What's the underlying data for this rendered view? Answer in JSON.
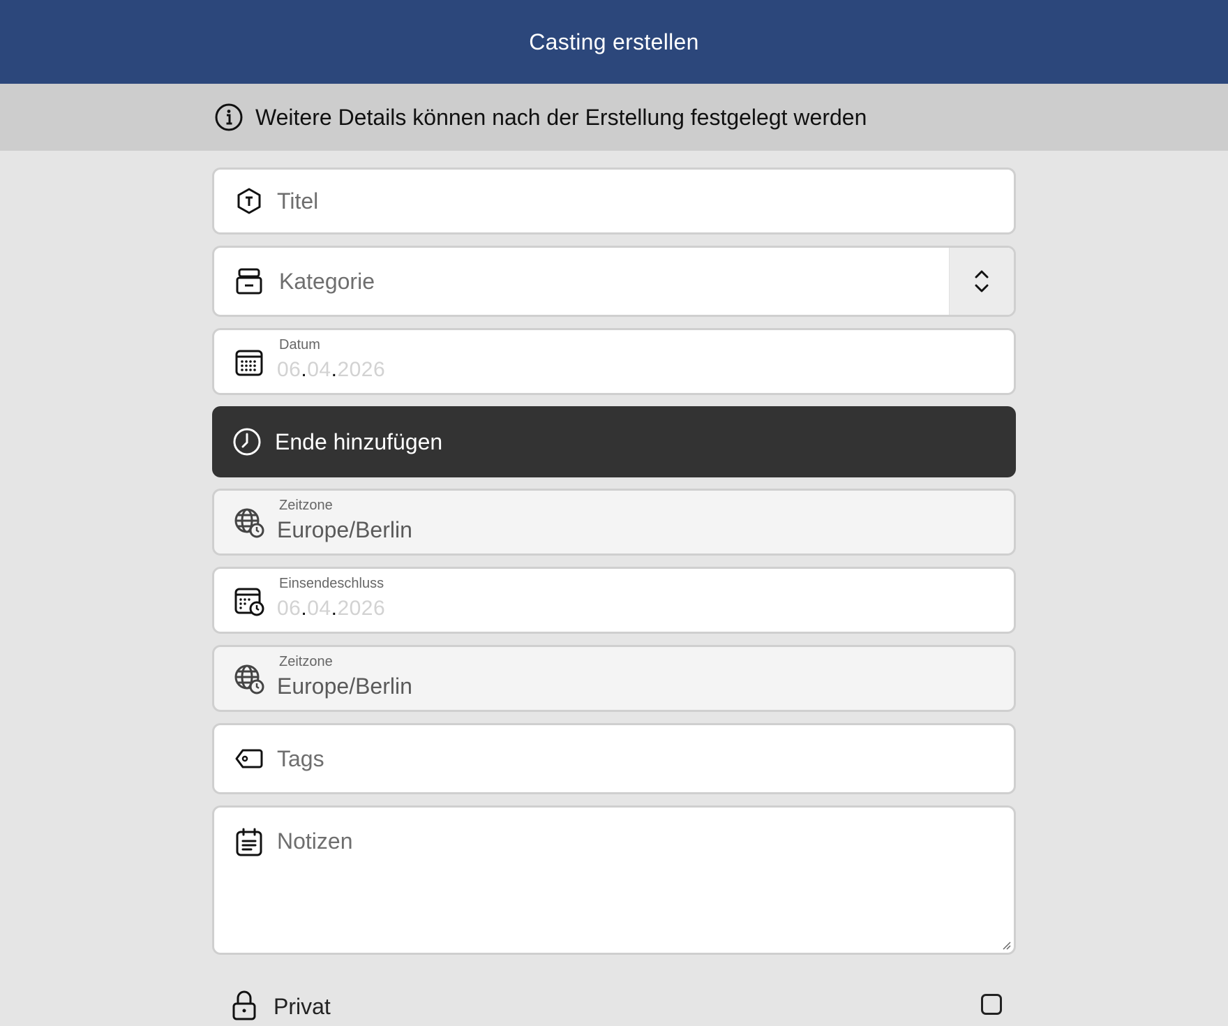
{
  "header": {
    "title": "Casting erstellen"
  },
  "info": {
    "text": "Weitere Details können nach der Erstellung festgelegt werden"
  },
  "form": {
    "title_placeholder": "Titel",
    "category_placeholder": "Kategorie",
    "date": {
      "label": "Datum",
      "day": "06",
      "month": "04",
      "year": "2026"
    },
    "add_end_label": "Ende hinzufügen",
    "timezone1": {
      "label": "Zeitzone",
      "value": "Europe/Berlin"
    },
    "deadline": {
      "label": "Einsendeschluss",
      "day": "06",
      "month": "04",
      "year": "2026"
    },
    "timezone2": {
      "label": "Zeitzone",
      "value": "Europe/Berlin"
    },
    "tags_placeholder": "Tags",
    "notes_placeholder": "Notizen",
    "private_label": "Privat"
  },
  "colors": {
    "header_bg": "#2c477b",
    "info_bg": "#cdcdcd",
    "dark_button": "#333333"
  }
}
